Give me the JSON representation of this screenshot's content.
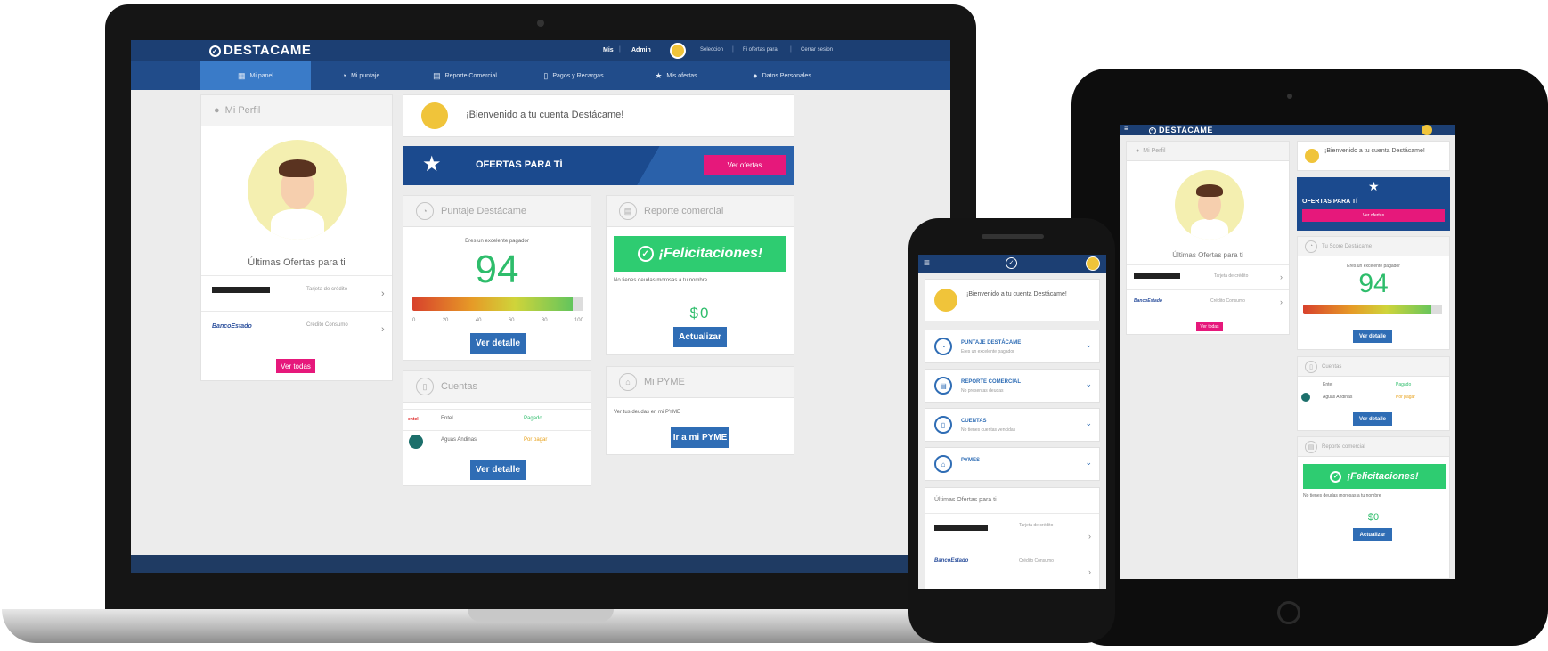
{
  "brand": "DESTACAME",
  "laptop": {
    "topbar": {
      "links": [
        "Mis",
        "Admin"
      ],
      "right_links": [
        "Seleccion",
        "Fi ofertas para",
        "Cerrar sesion"
      ]
    },
    "nav": [
      {
        "icon": "grid-icon",
        "label": "Mi panel"
      },
      {
        "icon": "gauge-icon",
        "label": "Mi puntaje"
      },
      {
        "icon": "report-icon",
        "label": "Reporte Comercial"
      },
      {
        "icon": "document-icon",
        "label": "Pagos y Recargas"
      },
      {
        "icon": "star-icon",
        "label": "Mis ofertas"
      },
      {
        "icon": "user-icon",
        "label": "Datos Personales"
      }
    ],
    "profile": {
      "title": "Mi Perfil",
      "offers_title": "Últimas Ofertas para ti",
      "offers": [
        {
          "type": "Tarjeta de crédito"
        },
        {
          "type": "Crédito Consumo",
          "logo": "BancoEstado"
        }
      ],
      "see_all": "Ver todas"
    },
    "welcome": "¡Bienvenido a tu cuenta Destácame!",
    "offers_banner": {
      "title": "OFERTAS PARA TÍ",
      "button": "Ver ofertas"
    },
    "score_card": {
      "title": "Puntaje Destácame",
      "subtitle": "Eres un excelente pagador",
      "score": "94",
      "ticks": [
        "0",
        "20",
        "40",
        "60",
        "80",
        "100"
      ],
      "button": "Ver detalle"
    },
    "report_card": {
      "title": "Reporte comercial",
      "banner": "¡Felicitaciones!",
      "note": "No tienes deudas morosas a tu nombre",
      "amount": "$0",
      "button": "Actualizar"
    },
    "accounts_card": {
      "title": "Cuentas",
      "rows": [
        {
          "name": "Entel",
          "status": "Pagado"
        },
        {
          "name": "Aguas Andinas",
          "status": "Por pagar"
        }
      ],
      "button": "Ver detalle"
    },
    "pyme_card": {
      "title": "Mi PYME",
      "text": "Ver tus deudas en mi PYME",
      "button": "Ir a mi PYME"
    }
  },
  "phone": {
    "welcome": "¡Bienvenido a tu cuenta Destácame!",
    "items": [
      {
        "title": "PUNTAJE DESTÁCAME",
        "sub": "Eres un excelente pagador"
      },
      {
        "title": "REPORTE COMERCIAL",
        "sub": "No presentas deudas"
      },
      {
        "title": "CUENTAS",
        "sub": "No tienes cuentas vencidas"
      },
      {
        "title": "PYMES",
        "sub": ""
      }
    ],
    "offers_title": "Últimas Ofertas para ti",
    "offers": [
      {
        "type": "Tarjeta de crédito"
      },
      {
        "type": "Crédito Consumo",
        "logo": "BancoEstado"
      }
    ]
  },
  "tablet": {
    "profile_title": "Mi Perfil",
    "welcome": "¡Bienvenido a tu cuenta Destácame!",
    "offers_banner": {
      "title": "OFERTAS PARA TÍ",
      "button": "Ver ofertas"
    },
    "score": {
      "title": "Tu Score Destácame",
      "subtitle": "Eres un excelente pagador",
      "value": "94",
      "button": "Ver detalle"
    },
    "offers_title": "Últimas Ofertas para ti",
    "offers": [
      {
        "type": "Tarjeta de crédito"
      },
      {
        "type": "Crédito Consumo",
        "logo": "BancoEstado"
      }
    ],
    "see_all": "Ver todas",
    "accounts": {
      "title": "Cuentas",
      "rows": [
        {
          "name": "Entel",
          "status": "Pagado"
        },
        {
          "name": "Aguas Andinas",
          "status": "Por pagar"
        }
      ],
      "button": "Ver detalle"
    },
    "report": {
      "title": "Reporte comercial",
      "banner": "¡Felicitaciones!",
      "note": "No tienes deudas morosas a tu nombre",
      "amount": "$0",
      "button": "Actualizar"
    }
  },
  "colors": {
    "navy": "#1c3f73",
    "nav": "#214c8a",
    "active": "#3a7bc8",
    "pink": "#e6187b",
    "green": "#2ecc71",
    "button": "#2f6db5"
  }
}
